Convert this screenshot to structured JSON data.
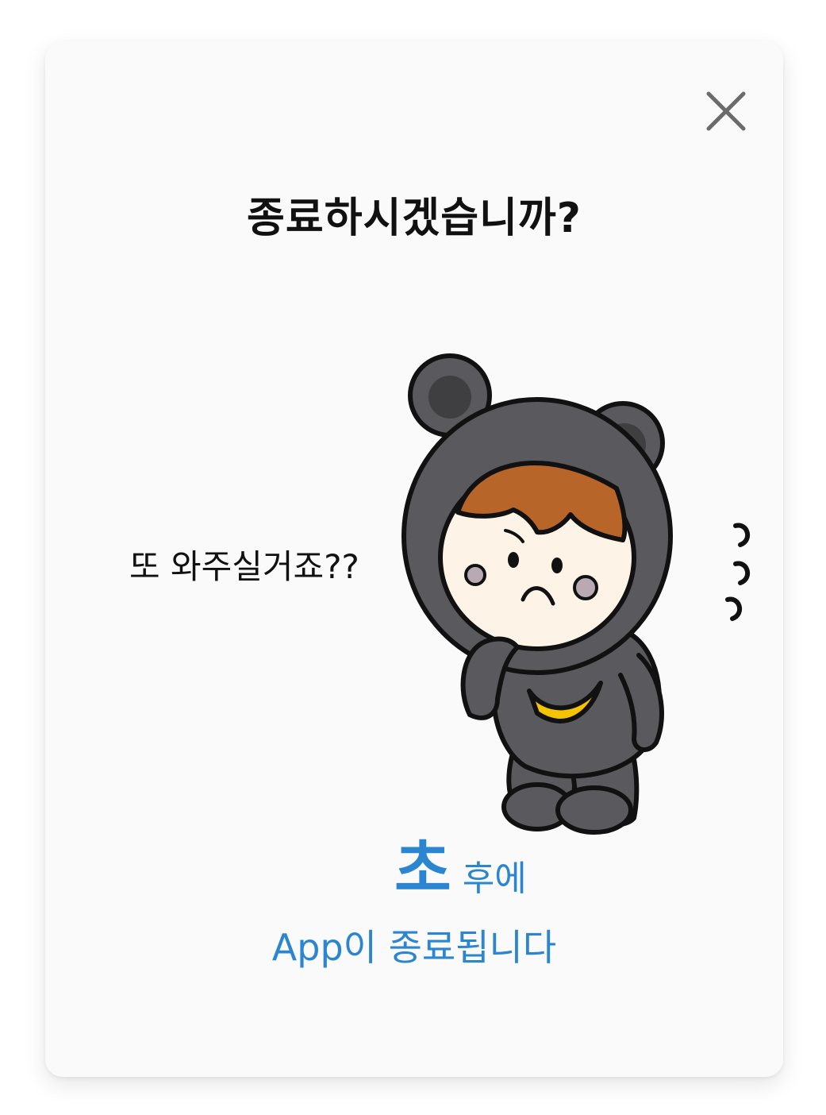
{
  "dialog": {
    "title": "종료하시겠습니까?",
    "speech_text": "또 와주실거죠??",
    "countdown": {
      "unit_label": "초",
      "suffix": "후에"
    },
    "exit_message": "App이 종료됩니다",
    "close_icon": "close-icon",
    "accent_color": "#2b85d0"
  }
}
